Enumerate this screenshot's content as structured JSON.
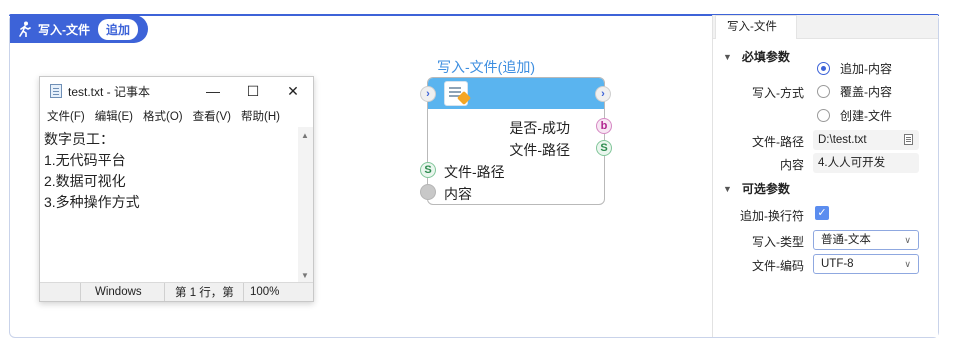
{
  "flow": {
    "title": "写入-文件",
    "mode_badge": "追加"
  },
  "notepad": {
    "window_title": "test.txt - 记事本",
    "controls": {
      "minimize": "—",
      "maximize": "☐",
      "close": "✕"
    },
    "menu": [
      "文件(F)",
      "编辑(E)",
      "格式(O)",
      "查看(V)",
      "帮助(H)"
    ],
    "lines": [
      "数字员工：",
      "1.无代码平台",
      "2.数据可视化",
      "3.多种操作方式"
    ],
    "status": {
      "encoding_label": "Windows",
      "position": "第 1 行，第",
      "zoom": "100%"
    }
  },
  "node": {
    "title": "写入-文件(追加)",
    "outputs": [
      {
        "label": "是否-成功",
        "type": "b"
      },
      {
        "label": "文件-路径",
        "type": "S"
      }
    ],
    "inputs": [
      {
        "label": "文件-路径",
        "type": "S"
      },
      {
        "label": "内容",
        "type": ""
      }
    ]
  },
  "panel": {
    "tab": "写入-文件",
    "required_section": "必填参数",
    "write_mode_label": "写入-方式",
    "write_mode_options": [
      {
        "label": "追加-内容",
        "selected": true
      },
      {
        "label": "覆盖-内容",
        "selected": false
      },
      {
        "label": "创建-文件",
        "selected": false
      }
    ],
    "file_path_label": "文件-路径",
    "file_path_value": "D:\\test.txt",
    "content_label": "内容",
    "content_value": "4.人人可开发",
    "optional_section": "可选参数",
    "newline_label": "追加-换行符",
    "newline_checked": true,
    "type_label": "写入-类型",
    "type_value": "普通-文本",
    "encoding_label": "文件-编码",
    "encoding_value": "UTF-8"
  },
  "colors": {
    "accent": "#3d63d8",
    "node_header": "#5ab4ef",
    "node_title": "#3d8ee0"
  }
}
